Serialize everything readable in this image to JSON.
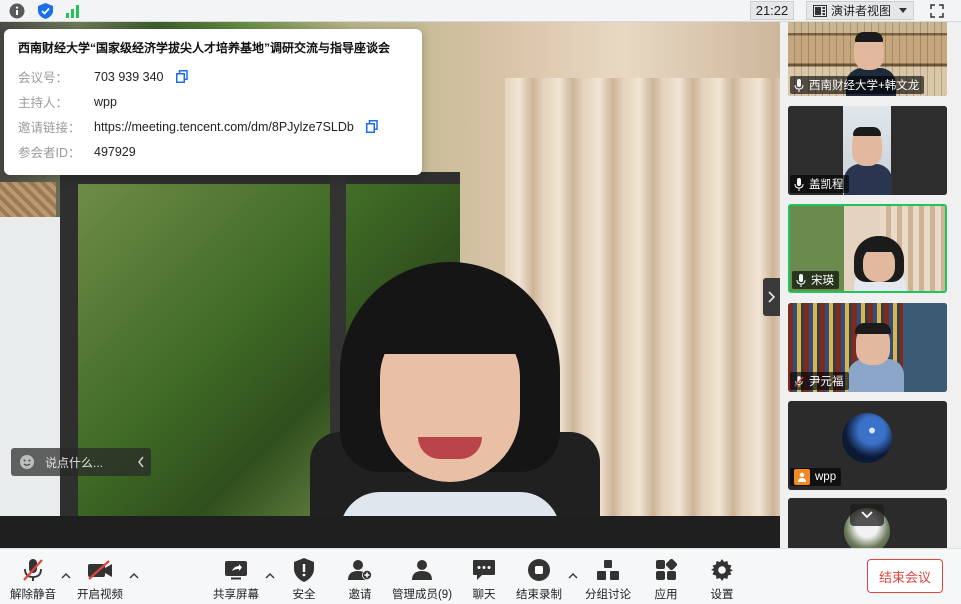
{
  "topbar": {
    "time": "21:22",
    "view_label": "演讲者视图",
    "icons": [
      "info-icon",
      "shield-icon",
      "signal-icon",
      "speaker-view-icon",
      "fullscreen-icon"
    ]
  },
  "meeting_info": {
    "title": "西南财经大学“国家级经济学拔尖人才培养基地”调研交流与指导座谈会",
    "rows": [
      {
        "label": "会议号：",
        "value": "703 939 340",
        "copy": true
      },
      {
        "label": "主持人：",
        "value": "wpp",
        "copy": false
      },
      {
        "label": "邀请链接：",
        "value": "https://meeting.tencent.com/dm/8PJylze7SLDb",
        "copy": true
      },
      {
        "label": "参会者ID：",
        "value": "497929",
        "copy": false
      }
    ]
  },
  "chat": {
    "placeholder": "说点什么..."
  },
  "participants": [
    {
      "name": "西南财经大学+韩文龙",
      "muted": false
    },
    {
      "name": "盖凯程",
      "muted": false
    },
    {
      "name": "宋瑛",
      "muted": false,
      "active": true
    },
    {
      "name": "尹元福",
      "muted": true
    },
    {
      "name": "wpp",
      "muted": false
    }
  ],
  "toolbar": {
    "unmute": "解除静音",
    "start_video": "开启视频",
    "share_screen": "共享屏幕",
    "security": "安全",
    "invite": "邀请",
    "manage_members": "管理成员(9)",
    "chat": "聊天",
    "end_recording": "结束录制",
    "breakout": "分组讨论",
    "apps": "应用",
    "settings": "设置",
    "end_meeting": "结束会议"
  },
  "colors": {
    "accent_blue": "#1a6fe8",
    "end_red": "#e0443e",
    "active_green": "#23c35b",
    "orange": "#f08a24"
  }
}
